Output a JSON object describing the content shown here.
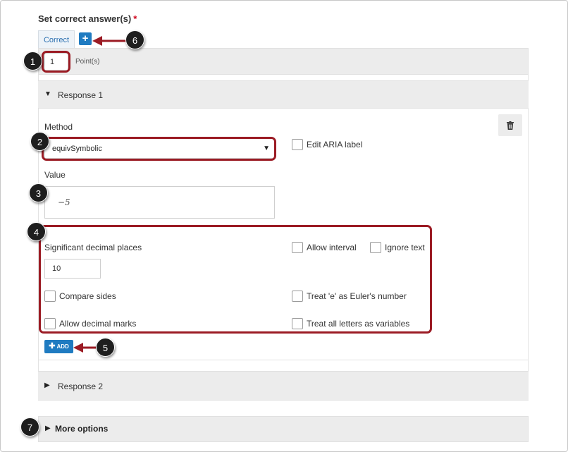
{
  "section": {
    "title": "Set correct answer(s)",
    "required_marker": "*"
  },
  "tabs": {
    "correct_label": "Correct",
    "add_label": "+"
  },
  "points": {
    "value": "1",
    "label": "Point(s)"
  },
  "response1": {
    "title": "Response 1",
    "method_label": "Method",
    "method_value": "equivSymbolic",
    "edit_aria_label": "Edit ARIA label",
    "value_label": "Value",
    "value": "−5",
    "sig_decimal_label": "Significant decimal places",
    "sig_decimal_value": "10",
    "allow_interval": "Allow interval",
    "ignore_text": "Ignore text",
    "compare_sides": "Compare sides",
    "treat_e": "Treat 'e' as Euler's number",
    "allow_decimal_marks": "Allow decimal marks",
    "treat_letters": "Treat all letters as variables",
    "add_label": "ADD"
  },
  "response2": {
    "title": "Response 2"
  },
  "more_options": {
    "title": "More options"
  },
  "annotations": [
    "1",
    "2",
    "3",
    "4",
    "5",
    "6",
    "7"
  ],
  "colors": {
    "accent": "#1f7bc1",
    "highlight": "#9b1b24",
    "required": "#d0021b"
  }
}
